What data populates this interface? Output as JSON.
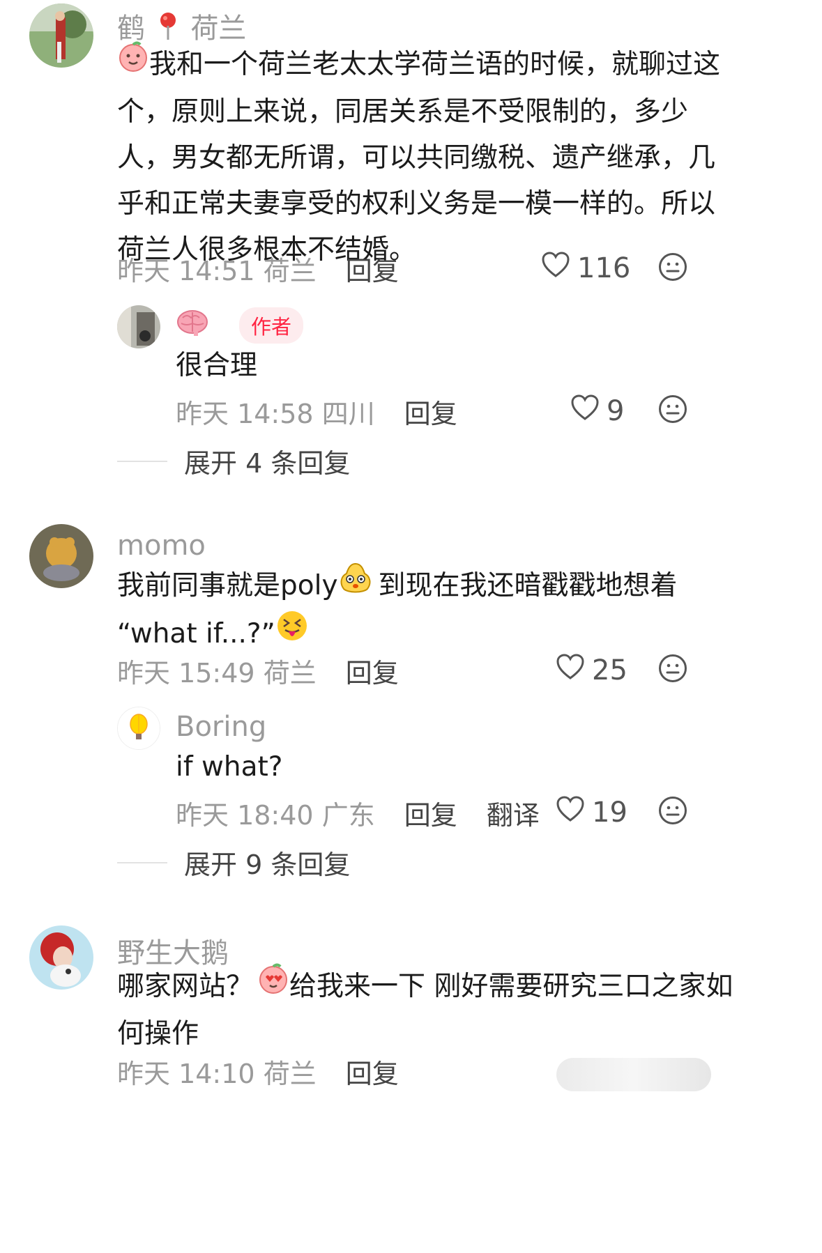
{
  "comments": [
    {
      "username": "鹤",
      "location_tag": "荷兰",
      "text_lines": [
        "我和一个荷兰老太太学荷兰语的时候，就聊过这",
        "个，原则上来说，同居关系是不受限制的，多少",
        "人，男女都无所谓，可以共同缴税、遗产继承，几",
        "乎和正常夫妻享受的权利义务是一模一样的。所以",
        "荷兰人很多根本不结婚。"
      ],
      "time": "昨天 14:51",
      "location": "荷兰",
      "reply_label": "回复",
      "likes": "116",
      "reply": {
        "author_badge": "作者",
        "text": "很合理",
        "time": "昨天 14:58",
        "location": "四川",
        "reply_label": "回复",
        "likes": "9"
      },
      "expand_label": "展开 4 条回复"
    },
    {
      "username": "momo",
      "text_line1": "我前同事就是poly",
      "text_line1_rest": "到现在我还暗戳戳地想着",
      "text_line2": "“what if...?”",
      "time": "昨天 15:49",
      "location": "荷兰",
      "reply_label": "回复",
      "likes": "25",
      "reply": {
        "username": "Boring",
        "text": "if what?",
        "time": "昨天 18:40",
        "location": "广东",
        "reply_label": "回复",
        "translate_label": "翻译",
        "likes": "19"
      },
      "expand_label": "展开 9 条回复"
    },
    {
      "username": "野生大鹅",
      "text_line1_a": "哪家网站？",
      "text_line1_b": "给我来一下 刚好需要研究三口之家如",
      "text_line2": "何操作",
      "time": "昨天 14:10",
      "location": "荷兰",
      "reply_label": "回复"
    }
  ],
  "colors": {
    "accent": "#ff2442",
    "badge_bg": "#fdecee",
    "meta_gray": "#9a9a9a",
    "text": "#1b1b1b"
  }
}
